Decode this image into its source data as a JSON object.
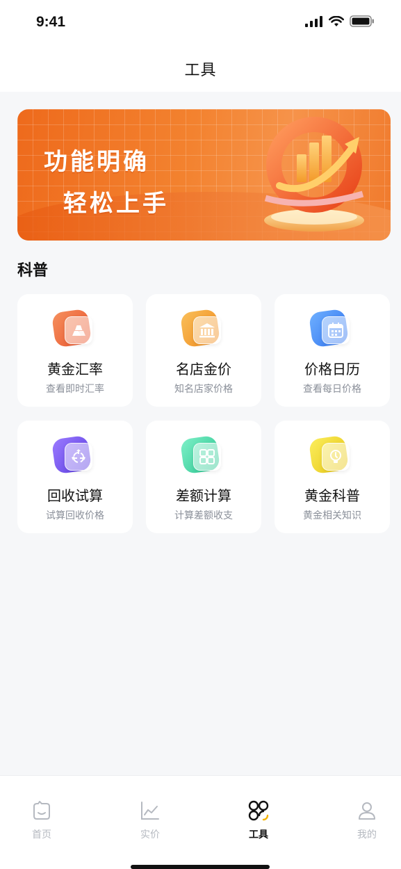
{
  "status_bar": {
    "time": "9:41"
  },
  "nav": {
    "title": "工具"
  },
  "banner": {
    "line1": "功能明确",
    "line2": "轻松上手"
  },
  "section": {
    "title": "科普"
  },
  "cards": [
    {
      "title": "黄金汇率",
      "subtitle": "查看即时汇率",
      "icon": "gold-bar-icon",
      "color": "#f07a4a"
    },
    {
      "title": "名店金价",
      "subtitle": "知名店家价格",
      "icon": "bank-icon",
      "color": "#f5a13c"
    },
    {
      "title": "价格日历",
      "subtitle": "查看每日价格",
      "icon": "calendar-icon",
      "color": "#4a8ff5"
    },
    {
      "title": "回收试算",
      "subtitle": "试算回收价格",
      "icon": "recycle-icon",
      "color": "#7b5cf0"
    },
    {
      "title": "差额计算",
      "subtitle": "计算差额收支",
      "icon": "calculator-icon",
      "color": "#3fd6a8"
    },
    {
      "title": "黄金科普",
      "subtitle": "黄金相关知识",
      "icon": "lightbulb-icon",
      "color": "#f2dc2a"
    }
  ],
  "tabbar": {
    "items": [
      {
        "label": "首页",
        "icon": "home-icon",
        "active": false
      },
      {
        "label": "实价",
        "icon": "chart-icon",
        "active": false
      },
      {
        "label": "工具",
        "icon": "tools-icon",
        "active": true
      },
      {
        "label": "我的",
        "icon": "profile-icon",
        "active": false
      }
    ]
  }
}
